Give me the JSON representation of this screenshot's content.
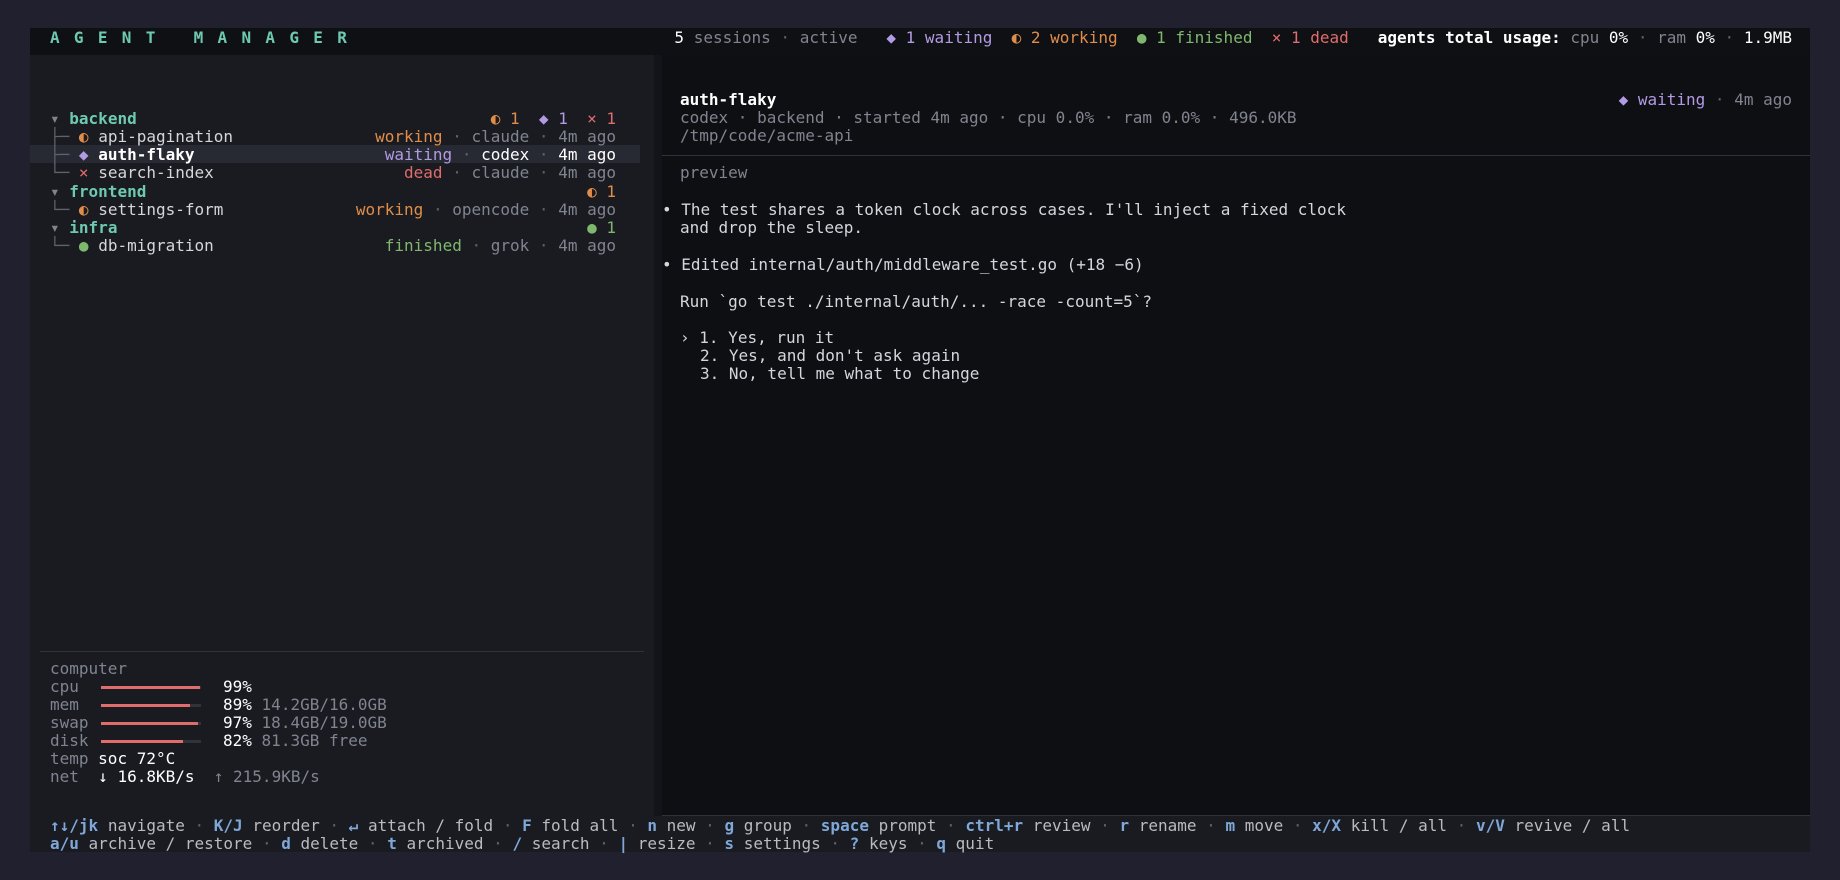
{
  "header": {
    "brand": "AGENT MANAGER",
    "sessions_count": "5",
    "sessions_label": "sessions",
    "sessions_state": "active",
    "waiting": "◆ 1 waiting",
    "working": "◐ 2 working",
    "finished": "● 1 finished",
    "dead": "× 1 dead",
    "usage_label": "agents total usage:",
    "cpu_label": "cpu",
    "cpu_value": "0%",
    "ram_label": "ram",
    "ram_value": "0%",
    "mem_value": "1.9MB"
  },
  "tree": {
    "groups": [
      {
        "name": "backend",
        "badges": [
          "◐ 1",
          "◆ 1",
          "× 1"
        ]
      },
      {
        "name": "frontend",
        "badges": [
          "◐ 1"
        ]
      },
      {
        "name": "infra",
        "badges": [
          "● 1"
        ]
      }
    ],
    "sessions": [
      {
        "icon": "◐",
        "name": "api-pagination",
        "status": "working",
        "agent": "claude",
        "age": "4m ago"
      },
      {
        "icon": "◆",
        "name": "auth-flaky",
        "status": "waiting",
        "agent": "codex",
        "age": "4m ago"
      },
      {
        "icon": "×",
        "name": "search-index",
        "status": "dead",
        "agent": "claude",
        "age": "4m ago"
      },
      {
        "icon": "◐",
        "name": "settings-form",
        "status": "working",
        "agent": "opencode",
        "age": "4m ago"
      },
      {
        "icon": "●",
        "name": "db-migration",
        "status": "finished",
        "agent": "grok",
        "age": "4m ago"
      }
    ]
  },
  "computer": {
    "title": "computer",
    "cpu": {
      "label": "cpu",
      "pct": "99%",
      "fraction": 0.99
    },
    "mem": {
      "label": "mem",
      "pct": "89%",
      "fraction": 0.89,
      "detail": "14.2GB/16.0GB"
    },
    "swap": {
      "label": "swap",
      "pct": "97%",
      "fraction": 0.97,
      "detail": "18.4GB/19.0GB"
    },
    "disk": {
      "label": "disk",
      "pct": "82%",
      "fraction": 0.82,
      "detail": "81.3GB free"
    },
    "temp": {
      "label": "temp",
      "value": "soc 72°C"
    },
    "net": {
      "label": "net",
      "down": "↓ 16.8KB/s",
      "up": "↑ 215.9KB/s"
    }
  },
  "detail": {
    "title": "auth-flaky",
    "status": "◆ waiting",
    "age": "4m ago",
    "meta": "codex · backend · started 4m ago · cpu 0.0% · ram 0.0% · 496.0KB",
    "path": "/tmp/code/acme-api",
    "preview_label": "preview",
    "bullet": "•",
    "msg1_line1": "The test shares a token clock across cases. I'll inject a fixed clock",
    "msg1_line2": "and drop the sleep.",
    "msg2": "Edited internal/auth/middleware_test.go (+18 −6)",
    "question": "Run `go test ./internal/auth/... -race -count=5`?",
    "cursor": "›",
    "options": [
      "1. Yes, run it",
      "2. Yes, and don't ask again",
      "3. No, tell me what to change"
    ]
  },
  "footer": {
    "row1": [
      {
        "key": "↑↓/jk",
        "label": "navigate"
      },
      {
        "key": "K/J",
        "label": "reorder"
      },
      {
        "key": "↵",
        "label": "attach / fold"
      },
      {
        "key": "F",
        "label": "fold all"
      },
      {
        "key": "n",
        "label": "new"
      },
      {
        "key": "g",
        "label": "group"
      },
      {
        "key": "space",
        "label": "prompt"
      },
      {
        "key": "ctrl+r",
        "label": "review"
      },
      {
        "key": "r",
        "label": "rename"
      },
      {
        "key": "m",
        "label": "move"
      },
      {
        "key": "x/X",
        "label": "kill / all"
      },
      {
        "key": "v/V",
        "label": "revive / all"
      }
    ],
    "row2": [
      {
        "key": "a/u",
        "label": "archive / restore"
      },
      {
        "key": "d",
        "label": "delete"
      },
      {
        "key": "t",
        "label": "archived"
      },
      {
        "key": "/",
        "label": "search"
      },
      {
        "key": "|",
        "label": "resize"
      },
      {
        "key": "s",
        "label": "settings"
      },
      {
        "key": "?",
        "label": "keys"
      },
      {
        "key": "q",
        "label": "quit"
      }
    ]
  },
  "colors": {
    "accent_teal": "#6dcab0",
    "waiting": "#b39ae4",
    "working": "#e08d4a",
    "finished": "#7fb86d",
    "dead": "#e06c6c",
    "key": "#7fa7d8"
  }
}
